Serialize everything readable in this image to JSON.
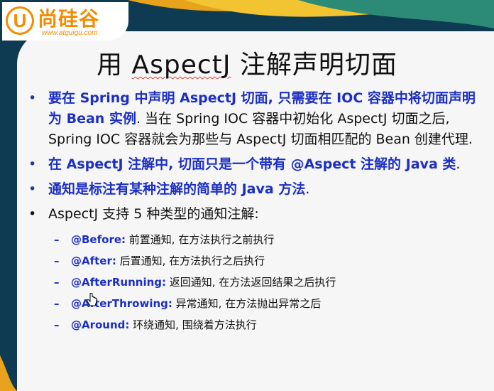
{
  "logo": {
    "letter": "U",
    "brand": "尚硅谷",
    "url": "www.atguigu.com"
  },
  "title": {
    "prefix": "用 ",
    "keyword": "AspectJ",
    "suffix": " 注解声明切面"
  },
  "bullets": [
    {
      "blue": "要在 Spring 中声明 AspectJ 切面, 只需要在 IOC 容器中将切面声明为 Bean 实例",
      "plain": ". 当在 Spring IOC 容器中初始化 AspectJ 切面之后, Spring IOC 容器就会为那些与 AspectJ 切面相匹配的 Bean 创建代理."
    },
    {
      "blue": "在 AspectJ 注解中, 切面只是一个带有 @Aspect 注解的 Java 类",
      "plain": "."
    },
    {
      "blue": "通知是标注有某种注解的简单的 Java 方法",
      "plain": "."
    },
    {
      "blue": "",
      "plain": "AspectJ 支持 5 种类型的通知注解:"
    }
  ],
  "advice": [
    {
      "name": "@Before:",
      "desc": " 前置通知, 在方法执行之前执行"
    },
    {
      "name": "@After:",
      "desc": " 后置通知, 在方法执行之后执行"
    },
    {
      "name": "@AfterRunning:",
      "desc": " 返回通知, 在方法返回结果之后执行"
    },
    {
      "name": "@AfterThrowing:",
      "desc": " 异常通知, 在方法抛出异常之后"
    },
    {
      "name": "@Around:",
      "desc": " 环绕通知, 围绕着方法执行"
    }
  ],
  "colors": {
    "accent_blue": "#1c2fc4",
    "brand_orange": "#f28c00",
    "background_teal": "#0f3b52"
  }
}
